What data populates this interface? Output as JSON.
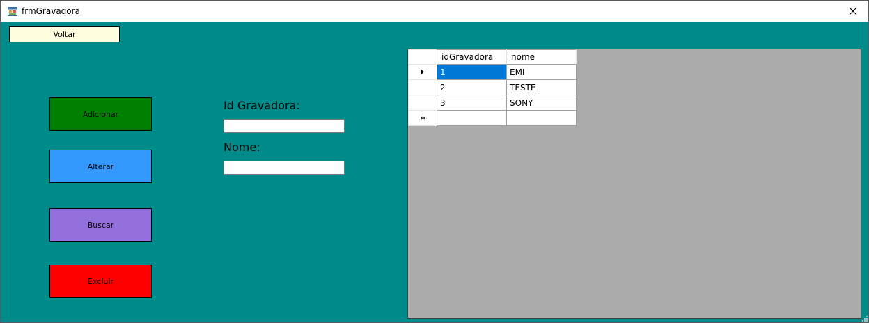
{
  "window": {
    "title": "frmGravadora"
  },
  "toolbar": {
    "voltar_label": "Voltar"
  },
  "actions": {
    "adicionar_label": "Adicionar",
    "alterar_label": "Alterar",
    "buscar_label": "Buscar",
    "excluir_label": "Excluir"
  },
  "form": {
    "id_label": "Id Gravadora:",
    "id_value": "",
    "nome_label": "Nome:",
    "nome_value": ""
  },
  "grid": {
    "columns": [
      "idGravadora",
      "nome"
    ],
    "rows": [
      {
        "id": "1",
        "nome": "EMI",
        "current": true
      },
      {
        "id": "2",
        "nome": "TESTE",
        "current": false
      },
      {
        "id": "3",
        "nome": "SONY",
        "current": false
      }
    ],
    "new_row_marker": "*"
  },
  "colors": {
    "form_background": "#008b8b",
    "voltar": "#ffffe0",
    "adicionar": "#008000",
    "alterar": "#3399ff",
    "buscar": "#9370db",
    "excluir": "#ff0000",
    "grid_background": "#ababab",
    "selection": "#0078d7"
  }
}
